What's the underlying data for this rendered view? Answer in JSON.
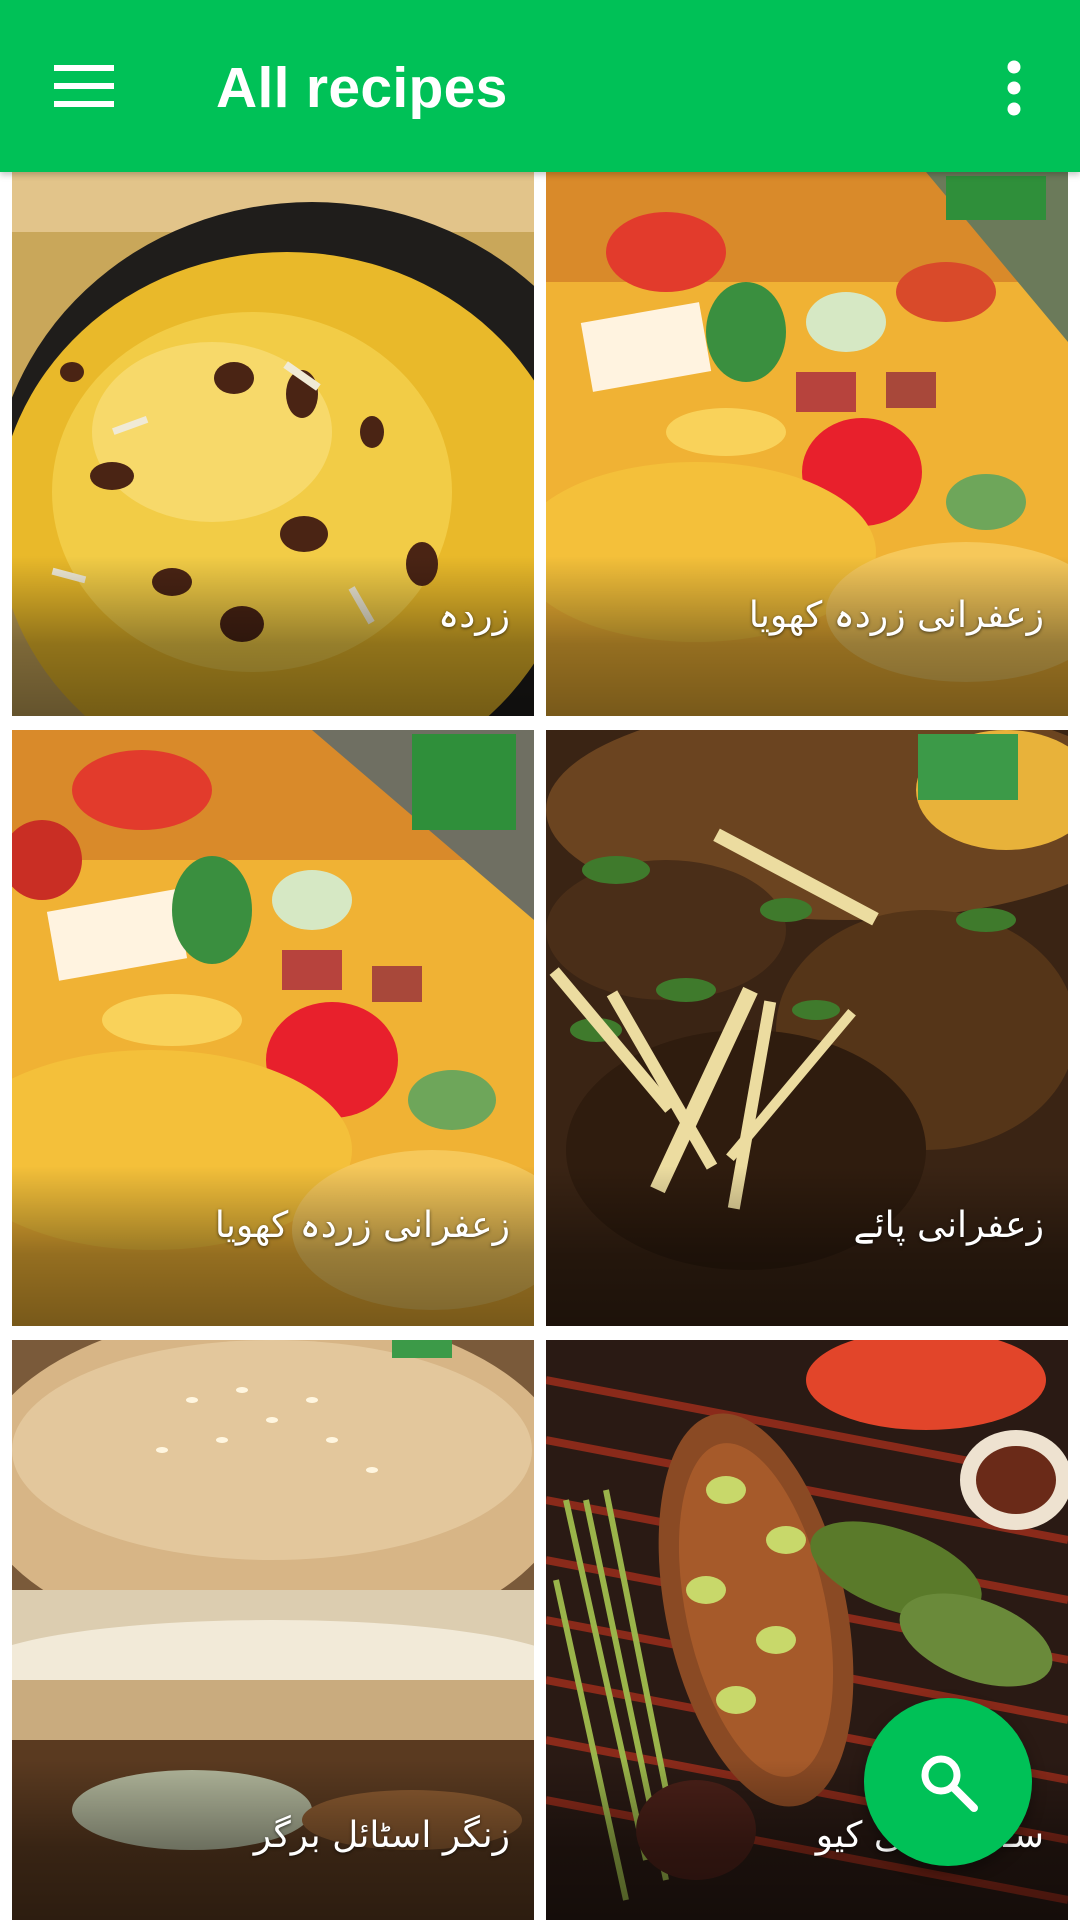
{
  "app_bar": {
    "title": "All recipes",
    "background_color": "#00c157",
    "menu_icon": "hamburger-menu-icon",
    "overflow_icon": "more-vertical-icon"
  },
  "recipes": [
    {
      "name": "زردہ",
      "image": "yellow sweet rice with raisins in black bowl"
    },
    {
      "name": "زعفرانی زردہ کھویا",
      "image": "colorful saffron rice with candied fruit"
    },
    {
      "name": "زعفرانی زردہ کھویا",
      "image": "colorful saffron rice with candied fruit"
    },
    {
      "name": "زعفرانی پائے",
      "image": "curry with ginger strips and coriander"
    },
    {
      "name": "زنگر اسٹائل برگر",
      "image": "sesame bun burger"
    },
    {
      "name": "سـ     ی باربی کیو",
      "image": "grilled fish with lime slices and vegetables"
    }
  ],
  "fab": {
    "icon": "search-icon",
    "color": "#00c157"
  }
}
